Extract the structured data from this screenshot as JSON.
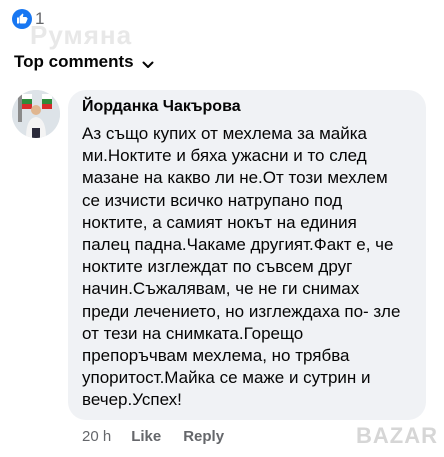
{
  "reactions": {
    "icon": "like-icon",
    "count": "1",
    "accent": "#1877f2"
  },
  "filter": {
    "label": "Top comments",
    "icon": "chevron-down-icon"
  },
  "comment": {
    "author": "Йорданка Чакърова",
    "lines": [
      "Аз също купих от мехлема за майка",
      "ми.Ноктите и бяха ужасни и то след",
      "мазане на какво ли не.От този мехлем",
      "се изчисти всичко натрупано под",
      "ноктите, а самият нокът на единия",
      "палец падна.Чакаме другият.Факт е, че",
      "ноктите изглеждат по съвсем друг",
      "начин.Съжалявам, че не ги снимах",
      "преди лечението, но изглеждаха по- зле",
      "от тези на снимката.Горещо",
      "препоръчвам мехлема, но трябва",
      "упоритост.Майка се маже и сутрин и",
      "вечер.Успех!"
    ],
    "time": "20 h",
    "like_label": "Like",
    "reply_label": "Reply"
  },
  "watermark": "BAZAR"
}
